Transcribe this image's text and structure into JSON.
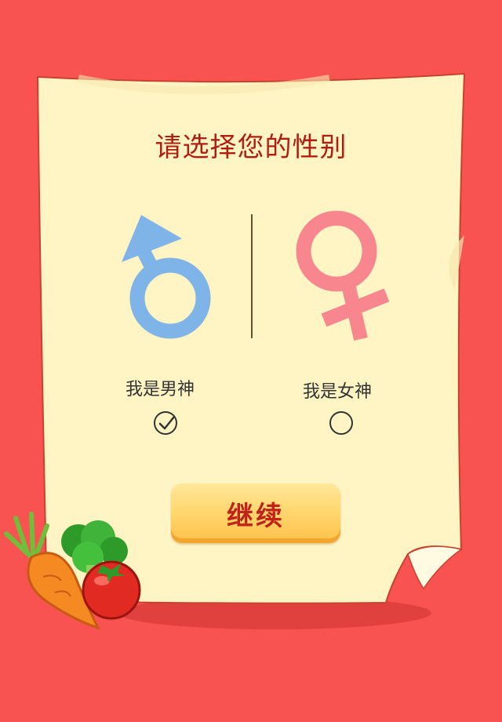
{
  "title": "请选择您的性别",
  "options": [
    {
      "label": "我是男神",
      "icon": "male-symbol-icon",
      "color": "#7fb4e8",
      "selected": true
    },
    {
      "label": "我是女神",
      "icon": "female-symbol-icon",
      "color": "#f8868e",
      "selected": false
    }
  ],
  "continue_label": "继续",
  "colors": {
    "background": "#f85350",
    "paper": "#fff5c4",
    "title": "#b01e12",
    "button": "#ffd770",
    "button_text": "#c0231b"
  }
}
